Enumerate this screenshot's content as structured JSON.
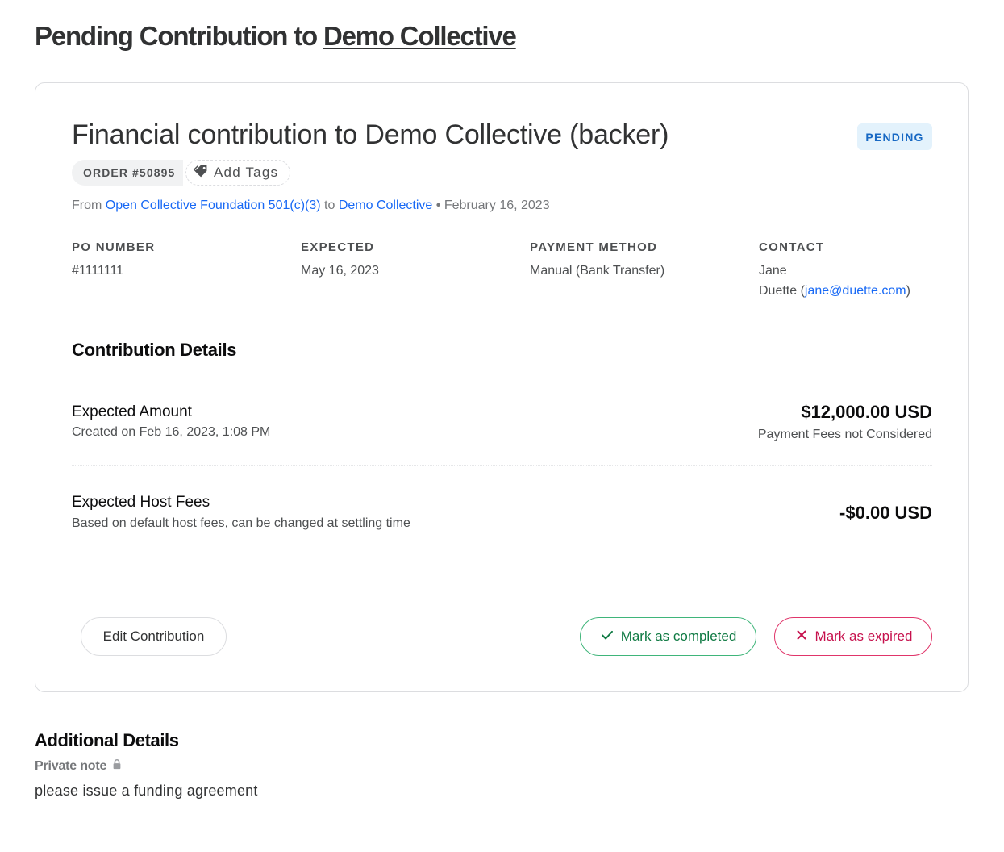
{
  "header": {
    "title_prefix": "Pending Contribution to",
    "collective_link": "Demo Collective"
  },
  "order": {
    "status": "PENDING",
    "title": "Financial contribution to Demo Collective (backer)",
    "order_id": "ORDER #50895",
    "add_tags_label": "Add Tags",
    "from_label": "From",
    "from_account": "Open Collective Foundation 501(c)(3)",
    "to_label": "to",
    "to_account": "Demo Collective",
    "separator": "•",
    "date": "February 16, 2023"
  },
  "info": {
    "po_number_label": "PO NUMBER",
    "po_number_value": "#1111111",
    "expected_label": "EXPECTED",
    "expected_value": "May 16, 2023",
    "payment_method_label": "PAYMENT METHOD",
    "payment_method_value": "Manual (Bank Transfer)",
    "contact_label": "CONTACT",
    "contact_first": "Jane",
    "contact_last": "Duette (",
    "contact_email": "jane@duette.com",
    "contact_close": ")"
  },
  "details": {
    "section_title": "Contribution Details",
    "expected_amount_label": "Expected Amount",
    "expected_amount_created": "Created on Feb 16, 2023, 1:08 PM",
    "expected_amount_value": "$12,000.00 USD",
    "expected_amount_note": "Payment Fees not Considered",
    "host_fees_label": "Expected Host Fees",
    "host_fees_sub": "Based on default host fees, can be changed at settling time",
    "host_fees_value": "-$0.00 USD"
  },
  "actions": {
    "edit_label": "Edit Contribution",
    "complete_label": "Mark as completed",
    "expire_label": "Mark as expired"
  },
  "additional": {
    "title": "Additional Details",
    "private_note_label": "Private note",
    "private_note_text": "please issue a funding agreement"
  },
  "colors": {
    "link": "#1869f5",
    "status_bg": "#e3f2fc",
    "status_text": "#1869c4",
    "success": "#0f7a43",
    "danger": "#c6114d"
  },
  "icons": {
    "tag": "tag-icon",
    "check": "check-icon",
    "close": "close-icon",
    "lock": "lock-icon"
  }
}
